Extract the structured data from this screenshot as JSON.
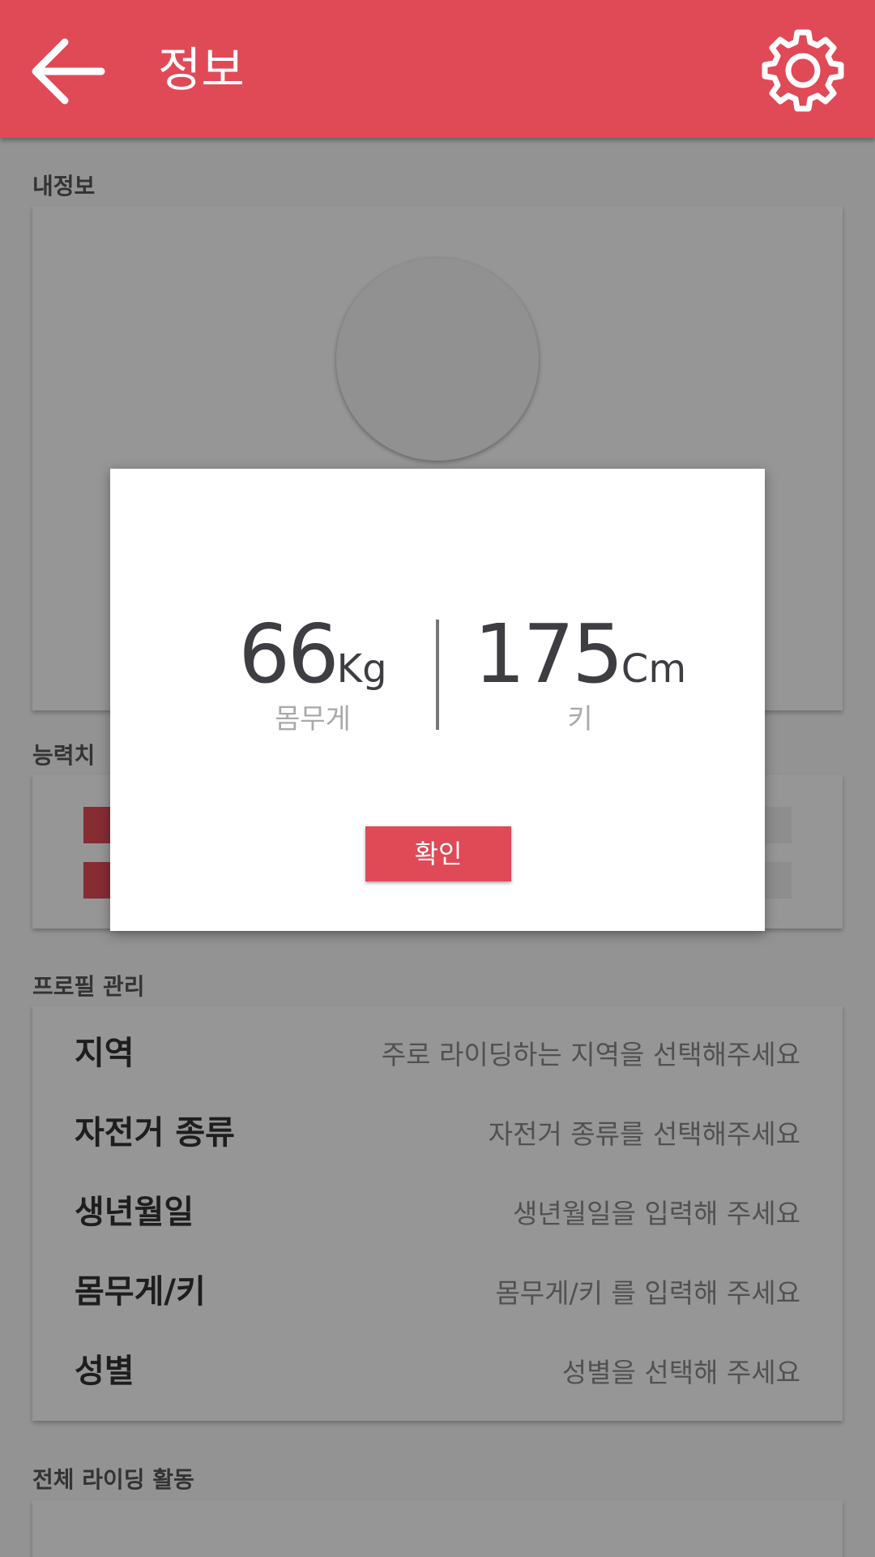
{
  "appbar": {
    "title": "정보"
  },
  "sections": {
    "my_info": "내정보",
    "ability": "능력치",
    "profile": "프로필 관리",
    "all_riding": "전체 라이딩 활동"
  },
  "ability": {
    "bar_levels": [
      0.32,
      0.1
    ]
  },
  "profile_rows": [
    {
      "label": "지역",
      "value": "주로 라이딩하는 지역을 선택해주세요"
    },
    {
      "label": "자전거 종류",
      "value": "자전거 종류를 선택해주세요"
    },
    {
      "label": "생년월일",
      "value": "생년월일을 입력해 주세요"
    },
    {
      "label": "몸무게/키",
      "value": "몸무게/키 를 입력해 주세요"
    },
    {
      "label": "성별",
      "value": "성별을 선택해 주세요"
    }
  ],
  "dialog": {
    "weight": {
      "value": "66",
      "unit": "Kg",
      "caption": "몸무게"
    },
    "height": {
      "value": "175",
      "unit": "Cm",
      "caption": "키"
    },
    "confirm_label": "확인"
  },
  "colors": {
    "accent": "#e04a56"
  },
  "icons": {
    "back": "arrow-left-icon",
    "settings": "gear-icon"
  }
}
